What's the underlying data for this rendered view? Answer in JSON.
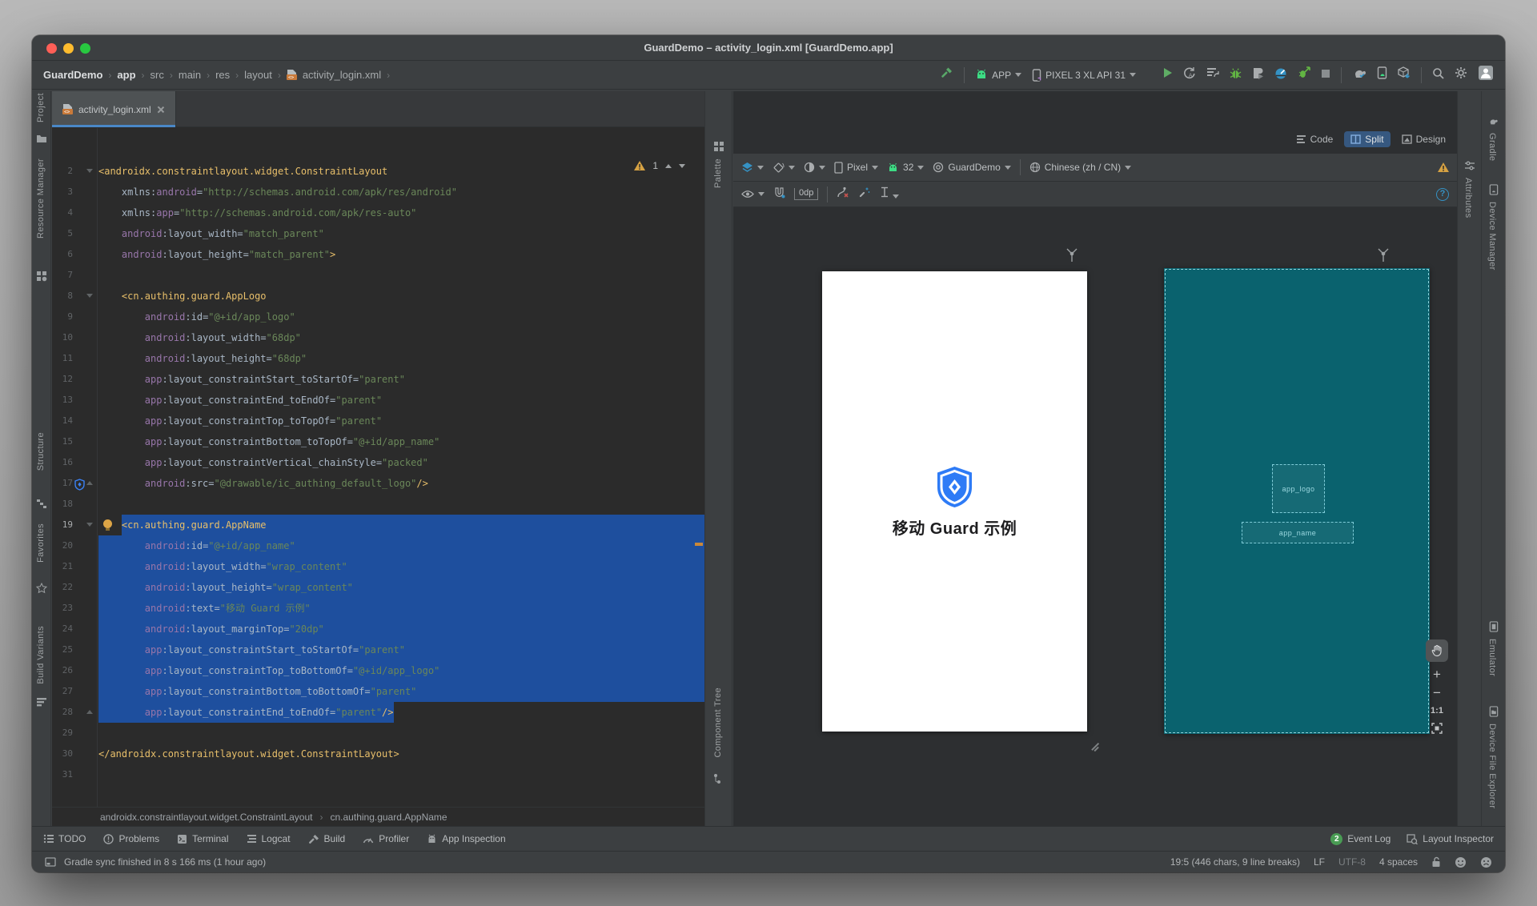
{
  "window": {
    "title": "GuardDemo – activity_login.xml [GuardDemo.app]"
  },
  "navbar": {
    "breadcrumbs": [
      "GuardDemo",
      "app",
      "src",
      "main",
      "res",
      "layout",
      "activity_login.xml"
    ],
    "chevron": "›",
    "run_config_label": "APP",
    "device_label": "PIXEL 3 XL API 31"
  },
  "tool_stripes": {
    "left": [
      "Project",
      "Resource Manager",
      "Structure",
      "Favorites",
      "Build Variants"
    ],
    "right_top": [
      "Gradle",
      "Device Manager"
    ],
    "right_bottom": [
      "Emulator",
      "Device File Explorer"
    ],
    "design_left_top": "Palette",
    "design_left_bottom": "Component Tree",
    "design_right": "Attributes"
  },
  "editor": {
    "tab_label": "activity_login.xml",
    "warning_count": "1",
    "lines": [
      {
        "n": 2,
        "g": [
          "fs"
        ],
        "t": [
          [
            "t",
            "<androidx.constraintlayout.widget.ConstraintLayout"
          ]
        ]
      },
      {
        "n": 3,
        "t": [
          [
            "w",
            "    "
          ],
          [
            "a",
            "xmlns"
          ],
          [
            "p",
            ":"
          ],
          [
            "n",
            "android"
          ],
          [
            "p",
            "="
          ],
          [
            "s",
            "\"http://schemas.android.com/apk/res/android\""
          ]
        ]
      },
      {
        "n": 4,
        "t": [
          [
            "w",
            "    "
          ],
          [
            "a",
            "xmlns"
          ],
          [
            "p",
            ":"
          ],
          [
            "n",
            "app"
          ],
          [
            "p",
            "="
          ],
          [
            "s",
            "\"http://schemas.android.com/apk/res-auto\""
          ]
        ]
      },
      {
        "n": 5,
        "t": [
          [
            "w",
            "    "
          ],
          [
            "n",
            "android"
          ],
          [
            "p",
            ":"
          ],
          [
            "a",
            "layout_width"
          ],
          [
            "p",
            "="
          ],
          [
            "s",
            "\"match_parent\""
          ]
        ]
      },
      {
        "n": 6,
        "t": [
          [
            "w",
            "    "
          ],
          [
            "n",
            "android"
          ],
          [
            "p",
            ":"
          ],
          [
            "a",
            "layout_height"
          ],
          [
            "p",
            "="
          ],
          [
            "s",
            "\"match_parent\""
          ],
          [
            "t",
            ">"
          ]
        ]
      },
      {
        "n": 7,
        "t": []
      },
      {
        "n": 8,
        "g": [
          "fs"
        ],
        "t": [
          [
            "w",
            "    "
          ],
          [
            "t",
            "<cn.authing.guard.AppLogo"
          ]
        ]
      },
      {
        "n": 9,
        "t": [
          [
            "w",
            "        "
          ],
          [
            "n",
            "android"
          ],
          [
            "p",
            ":"
          ],
          [
            "a",
            "id"
          ],
          [
            "p",
            "="
          ],
          [
            "s",
            "\"@+id/app_logo\""
          ]
        ]
      },
      {
        "n": 10,
        "t": [
          [
            "w",
            "        "
          ],
          [
            "n",
            "android"
          ],
          [
            "p",
            ":"
          ],
          [
            "a",
            "layout_width"
          ],
          [
            "p",
            "="
          ],
          [
            "s",
            "\"68dp\""
          ]
        ]
      },
      {
        "n": 11,
        "t": [
          [
            "w",
            "        "
          ],
          [
            "n",
            "android"
          ],
          [
            "p",
            ":"
          ],
          [
            "a",
            "layout_height"
          ],
          [
            "p",
            "="
          ],
          [
            "s",
            "\"68dp\""
          ]
        ]
      },
      {
        "n": 12,
        "t": [
          [
            "w",
            "        "
          ],
          [
            "n",
            "app"
          ],
          [
            "p",
            ":"
          ],
          [
            "a",
            "layout_constraintStart_toStartOf"
          ],
          [
            "p",
            "="
          ],
          [
            "s",
            "\"parent\""
          ]
        ]
      },
      {
        "n": 13,
        "t": [
          [
            "w",
            "        "
          ],
          [
            "n",
            "app"
          ],
          [
            "p",
            ":"
          ],
          [
            "a",
            "layout_constraintEnd_toEndOf"
          ],
          [
            "p",
            "="
          ],
          [
            "s",
            "\"parent\""
          ]
        ]
      },
      {
        "n": 14,
        "t": [
          [
            "w",
            "        "
          ],
          [
            "n",
            "app"
          ],
          [
            "p",
            ":"
          ],
          [
            "a",
            "layout_constraintTop_toTopOf"
          ],
          [
            "p",
            "="
          ],
          [
            "s",
            "\"parent\""
          ]
        ]
      },
      {
        "n": 15,
        "t": [
          [
            "w",
            "        "
          ],
          [
            "n",
            "app"
          ],
          [
            "p",
            ":"
          ],
          [
            "a",
            "layout_constraintBottom_toTopOf"
          ],
          [
            "p",
            "="
          ],
          [
            "s",
            "\"@+id/app_name\""
          ]
        ]
      },
      {
        "n": 16,
        "t": [
          [
            "w",
            "        "
          ],
          [
            "n",
            "app"
          ],
          [
            "p",
            ":"
          ],
          [
            "a",
            "layout_constraintVertical_chainStyle"
          ],
          [
            "p",
            "="
          ],
          [
            "s",
            "\"packed\""
          ]
        ]
      },
      {
        "n": 17,
        "g": [
          "fe",
          "shield"
        ],
        "t": [
          [
            "w",
            "        "
          ],
          [
            "n",
            "android"
          ],
          [
            "p",
            ":"
          ],
          [
            "a",
            "src"
          ],
          [
            "p",
            "="
          ],
          [
            "s",
            "\"@drawable/ic_authing_default_logo\""
          ],
          [
            "t",
            "/>"
          ]
        ]
      },
      {
        "n": 18,
        "t": []
      },
      {
        "n": 19,
        "cur": true,
        "g": [
          "fs",
          "bulb"
        ],
        "hl": "text",
        "t": [
          [
            "w",
            "    "
          ],
          [
            "t",
            "<cn.authing.guard.AppName"
          ]
        ]
      },
      {
        "n": 20,
        "hl": "row",
        "t": [
          [
            "w",
            "        "
          ],
          [
            "n",
            "android"
          ],
          [
            "p",
            ":"
          ],
          [
            "a",
            "id"
          ],
          [
            "p",
            "="
          ],
          [
            "s",
            "\"@+id/app_name\""
          ]
        ]
      },
      {
        "n": 21,
        "hl": "row",
        "t": [
          [
            "w",
            "        "
          ],
          [
            "n",
            "android"
          ],
          [
            "p",
            ":"
          ],
          [
            "a",
            "layout_width"
          ],
          [
            "p",
            "="
          ],
          [
            "s",
            "\"wrap_content\""
          ]
        ]
      },
      {
        "n": 22,
        "hl": "row",
        "t": [
          [
            "w",
            "        "
          ],
          [
            "n",
            "android"
          ],
          [
            "p",
            ":"
          ],
          [
            "a",
            "layout_height"
          ],
          [
            "p",
            "="
          ],
          [
            "s",
            "\"wrap_content\""
          ]
        ]
      },
      {
        "n": 23,
        "hl": "row",
        "t": [
          [
            "w",
            "        "
          ],
          [
            "n",
            "android"
          ],
          [
            "p",
            ":"
          ],
          [
            "a",
            "text"
          ],
          [
            "p",
            "="
          ],
          [
            "s",
            "\"移动 Guard 示例\""
          ]
        ]
      },
      {
        "n": 24,
        "hl": "row",
        "t": [
          [
            "w",
            "        "
          ],
          [
            "n",
            "android"
          ],
          [
            "p",
            ":"
          ],
          [
            "a",
            "layout_marginTop"
          ],
          [
            "p",
            "="
          ],
          [
            "s",
            "\"20dp\""
          ]
        ]
      },
      {
        "n": 25,
        "hl": "row",
        "t": [
          [
            "w",
            "        "
          ],
          [
            "n",
            "app"
          ],
          [
            "p",
            ":"
          ],
          [
            "a",
            "layout_constraintStart_toStartOf"
          ],
          [
            "p",
            "="
          ],
          [
            "s",
            "\"parent\""
          ]
        ]
      },
      {
        "n": 26,
        "hl": "row",
        "t": [
          [
            "w",
            "        "
          ],
          [
            "n",
            "app"
          ],
          [
            "p",
            ":"
          ],
          [
            "a",
            "layout_constraintTop_toBottomOf"
          ],
          [
            "p",
            "="
          ],
          [
            "s",
            "\"@+id/app_logo\""
          ]
        ]
      },
      {
        "n": 27,
        "hl": "row",
        "t": [
          [
            "w",
            "        "
          ],
          [
            "n",
            "app"
          ],
          [
            "p",
            ":"
          ],
          [
            "a",
            "layout_constraintBottom_toBottomOf"
          ],
          [
            "p",
            "="
          ],
          [
            "s",
            "\"parent\""
          ]
        ]
      },
      {
        "n": 28,
        "g": [
          "fe"
        ],
        "hl": "span",
        "t": [
          [
            "w",
            "        "
          ],
          [
            "n",
            "app"
          ],
          [
            "p",
            ":"
          ],
          [
            "a",
            "layout_constraintEnd_toEndOf"
          ],
          [
            "p",
            "="
          ],
          [
            "s",
            "\"parent\""
          ],
          [
            "t",
            "/>"
          ]
        ]
      },
      {
        "n": 29,
        "t": []
      },
      {
        "n": 30,
        "t": [
          [
            "t",
            "</androidx.constraintlayout.widget.ConstraintLayout>"
          ]
        ]
      },
      {
        "n": 31,
        "t": []
      }
    ]
  },
  "design": {
    "modes": [
      "Code",
      "Split",
      "Design"
    ],
    "active_mode": "Split",
    "device": "Pixel",
    "api_level": "32",
    "theme": "GuardDemo",
    "locale": "Chinese (zh / CN)",
    "default_margins": "0dp",
    "help_glyph": "?",
    "zoom_label": "1:1",
    "preview_app_name": "移动 Guard 示例",
    "blueprint_labels": {
      "logo": "app_logo",
      "name": "app_name"
    }
  },
  "bottom": {
    "xml_breadcrumbs": [
      "androidx.constraintlayout.widget.ConstraintLayout",
      "cn.authing.guard.AppName"
    ],
    "chevron": "›",
    "tools": [
      "TODO",
      "Problems",
      "Terminal",
      "Logcat",
      "Build",
      "Profiler",
      "App Inspection"
    ],
    "event_log_count": "2",
    "event_log_label": "Event Log",
    "layout_inspector_label": "Layout Inspector",
    "status_message": "Gradle sync finished in 8 s 166 ms (1 hour ago)",
    "caret_info": "19:5 (446 chars, 9 line breaks)",
    "line_separator": "LF",
    "encoding": "UTF-8",
    "indent_config": "4 spaces"
  },
  "colors": {
    "selection_blue": "#1e4f9e",
    "blueprint_teal": "#0a626e",
    "logo_blue": "#2e7bf6",
    "accent_blue": "#3592c4",
    "run_green": "#5fad65",
    "warning_orange": "#d6a243"
  }
}
